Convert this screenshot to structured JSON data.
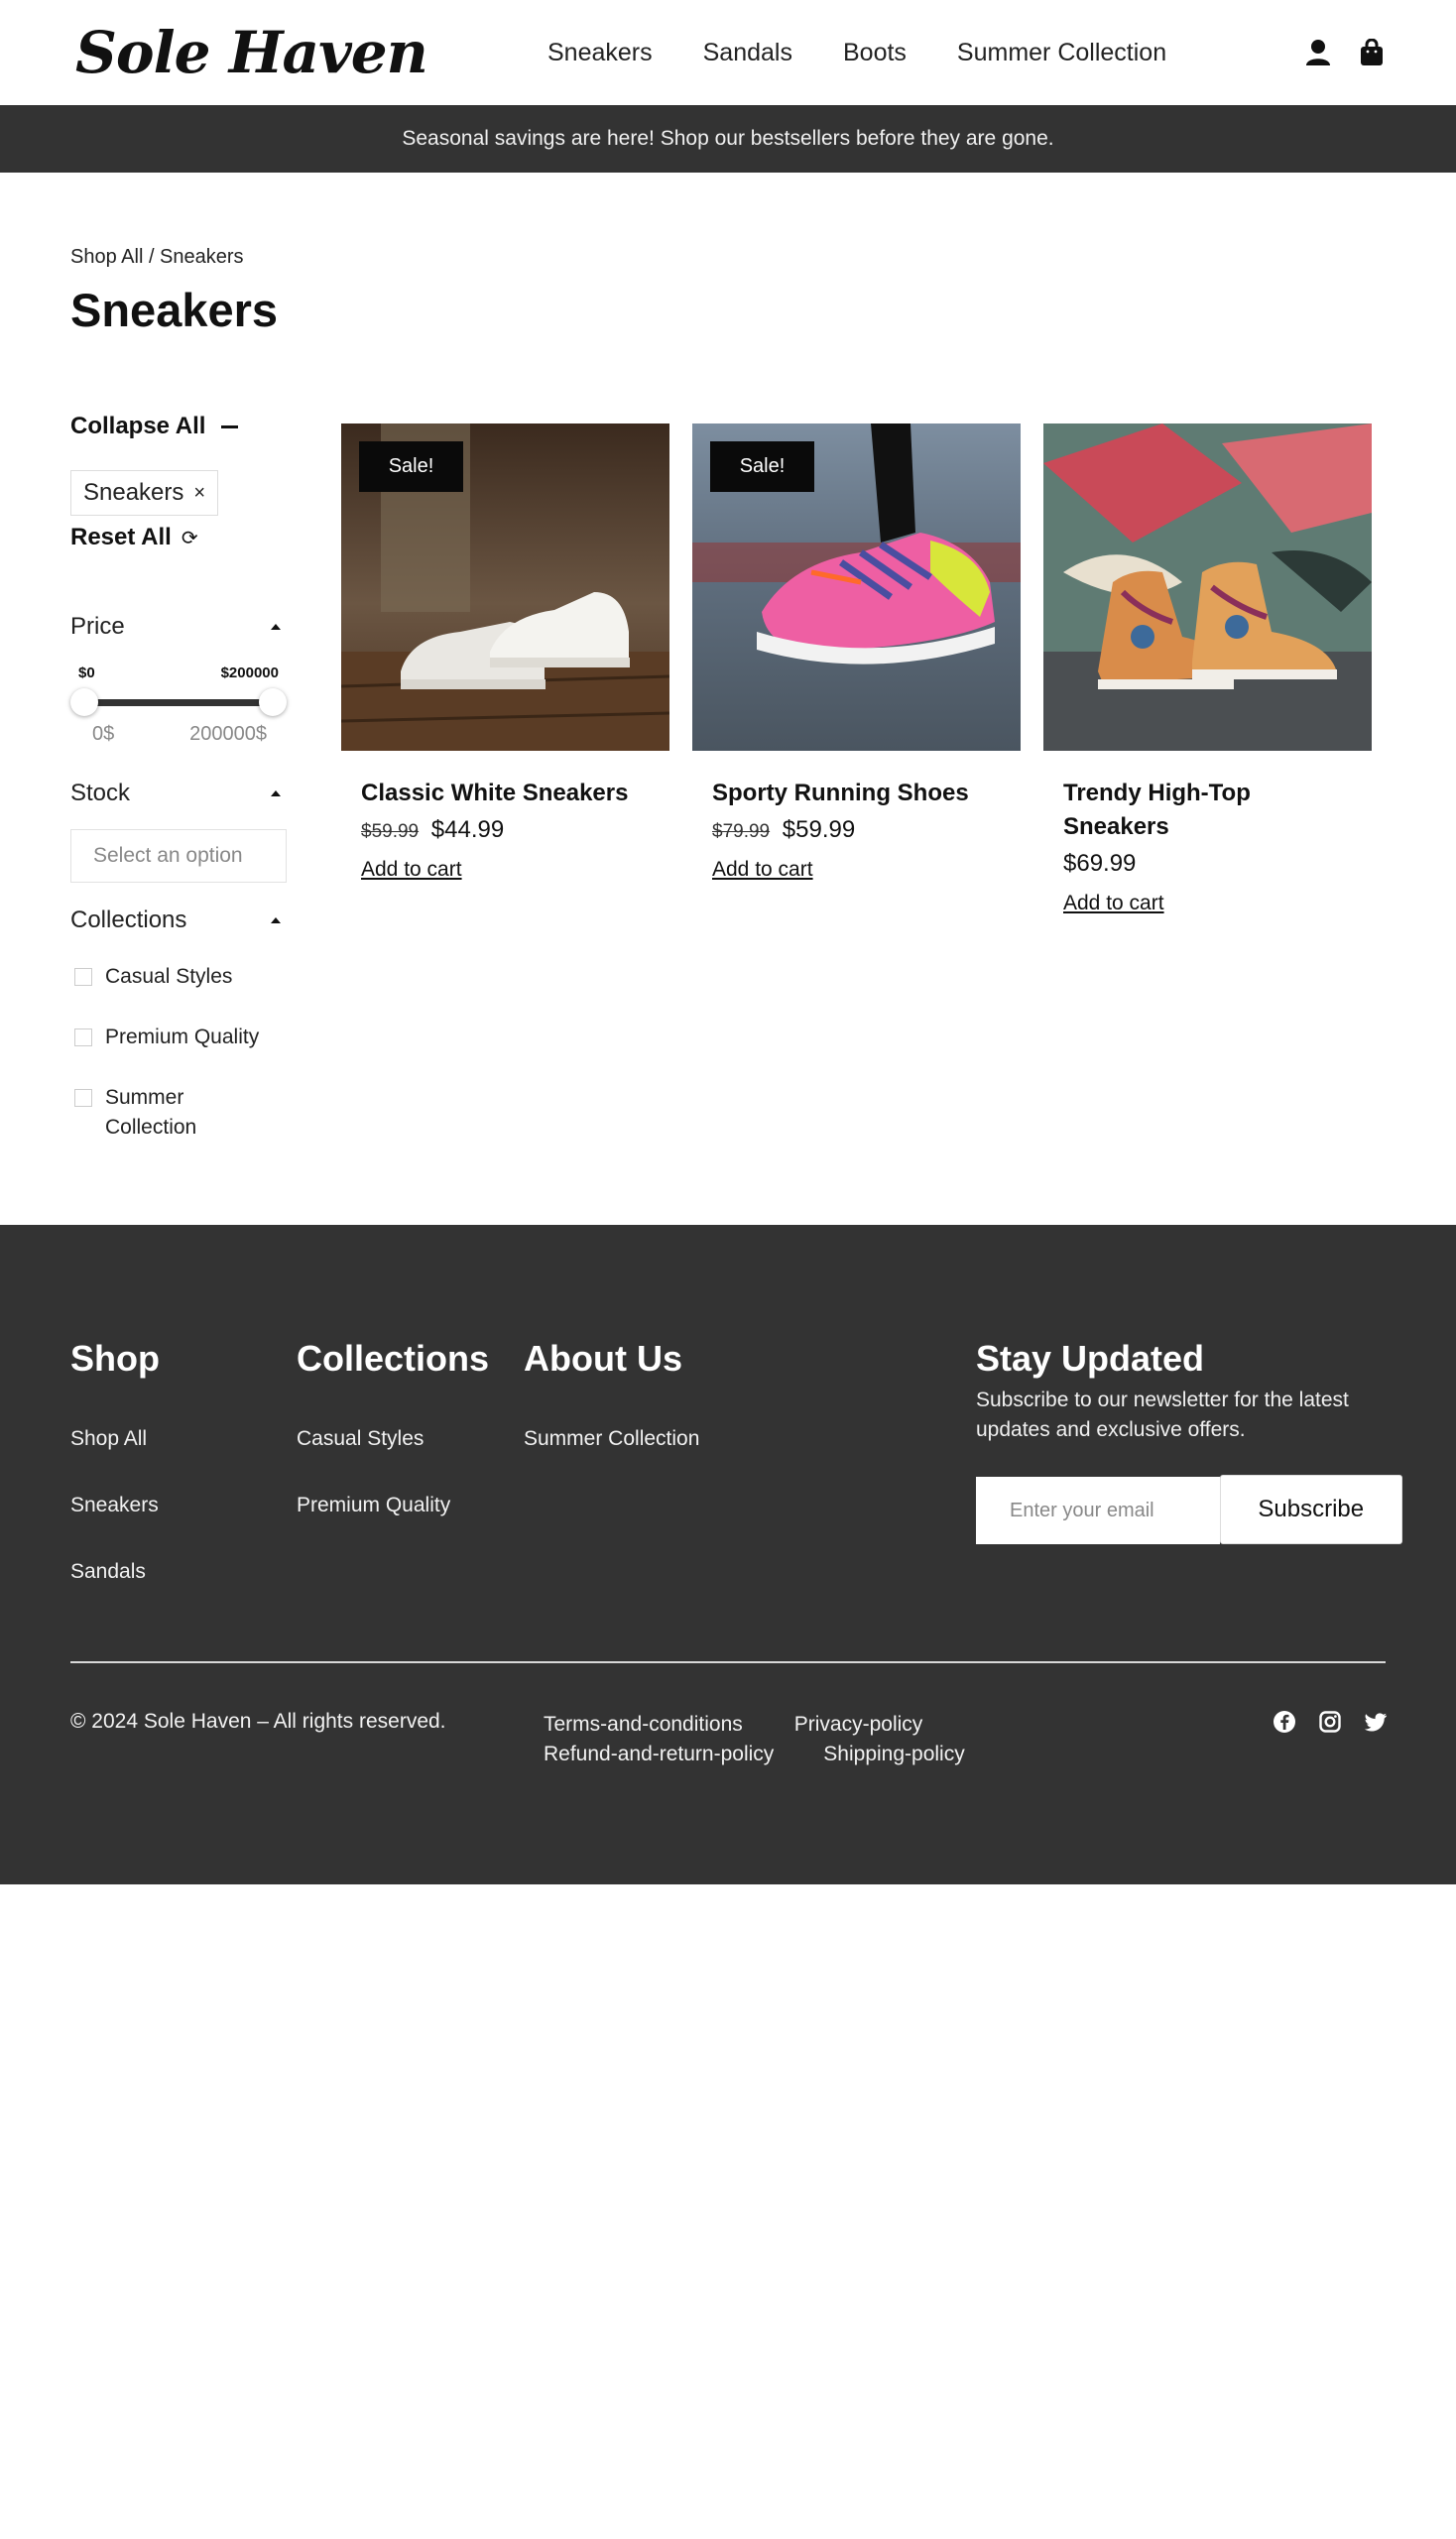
{
  "brand": {
    "logo": "Sole Haven"
  },
  "nav": [
    "Sneakers",
    "Sandals",
    "Boots",
    "Summer Collection"
  ],
  "header_icons": {
    "account": "user-icon",
    "cart": "shopping-bag-icon"
  },
  "announcement": "Seasonal savings are here! Shop our bestsellers before they are gone.",
  "breadcrumb": "Shop All / Sneakers",
  "page_title": "Sneakers",
  "sidebar": {
    "collapse_all": "Collapse All",
    "active_filter": "Sneakers",
    "active_filter_remove": "×",
    "reset_all": "Reset All",
    "price": {
      "label": "Price",
      "min_label": "$0",
      "max_label": "$200000",
      "min_value": "0$",
      "max_value": "200000$"
    },
    "stock": {
      "label": "Stock",
      "placeholder": "Select an option"
    },
    "collections": {
      "label": "Collections",
      "options": [
        "Casual Styles",
        "Premium Quality",
        "Summer Collection"
      ]
    }
  },
  "products": [
    {
      "name": "Classic White Sneakers",
      "badge": "Sale!",
      "old_price": "$59.99",
      "price": "$44.99",
      "cta": "Add to cart"
    },
    {
      "name": "Sporty Running Shoes",
      "badge": "Sale!",
      "old_price": "$79.99",
      "price": "$59.99",
      "cta": "Add to cart"
    },
    {
      "name": "Trendy High-Top Sneakers",
      "badge": "",
      "old_price": "",
      "price": "$69.99",
      "cta": "Add to cart"
    }
  ],
  "footer": {
    "shop": {
      "title": "Shop",
      "links": [
        "Shop All",
        "Sneakers",
        "Sandals"
      ]
    },
    "collections": {
      "title": "Collections",
      "links": [
        "Casual Styles",
        "Premium Quality"
      ]
    },
    "about": {
      "title": "About Us",
      "links": [
        "Summer Collection"
      ]
    },
    "newsletter": {
      "title": "Stay Updated",
      "text": "Subscribe to our newsletter for the latest updates and exclusive offers.",
      "placeholder": "Enter your email",
      "button": "Subscribe"
    },
    "copyright": "© 2024 Sole Haven – All rights reserved.",
    "policies": [
      "Terms-and-conditions",
      "Privacy-policy",
      "Refund-and-return-policy",
      "Shipping-policy"
    ],
    "socials": [
      "facebook-icon",
      "instagram-icon",
      "twitter-icon"
    ]
  },
  "colors": {
    "dark_band": "#333333",
    "accent": "#0a0a0a"
  }
}
